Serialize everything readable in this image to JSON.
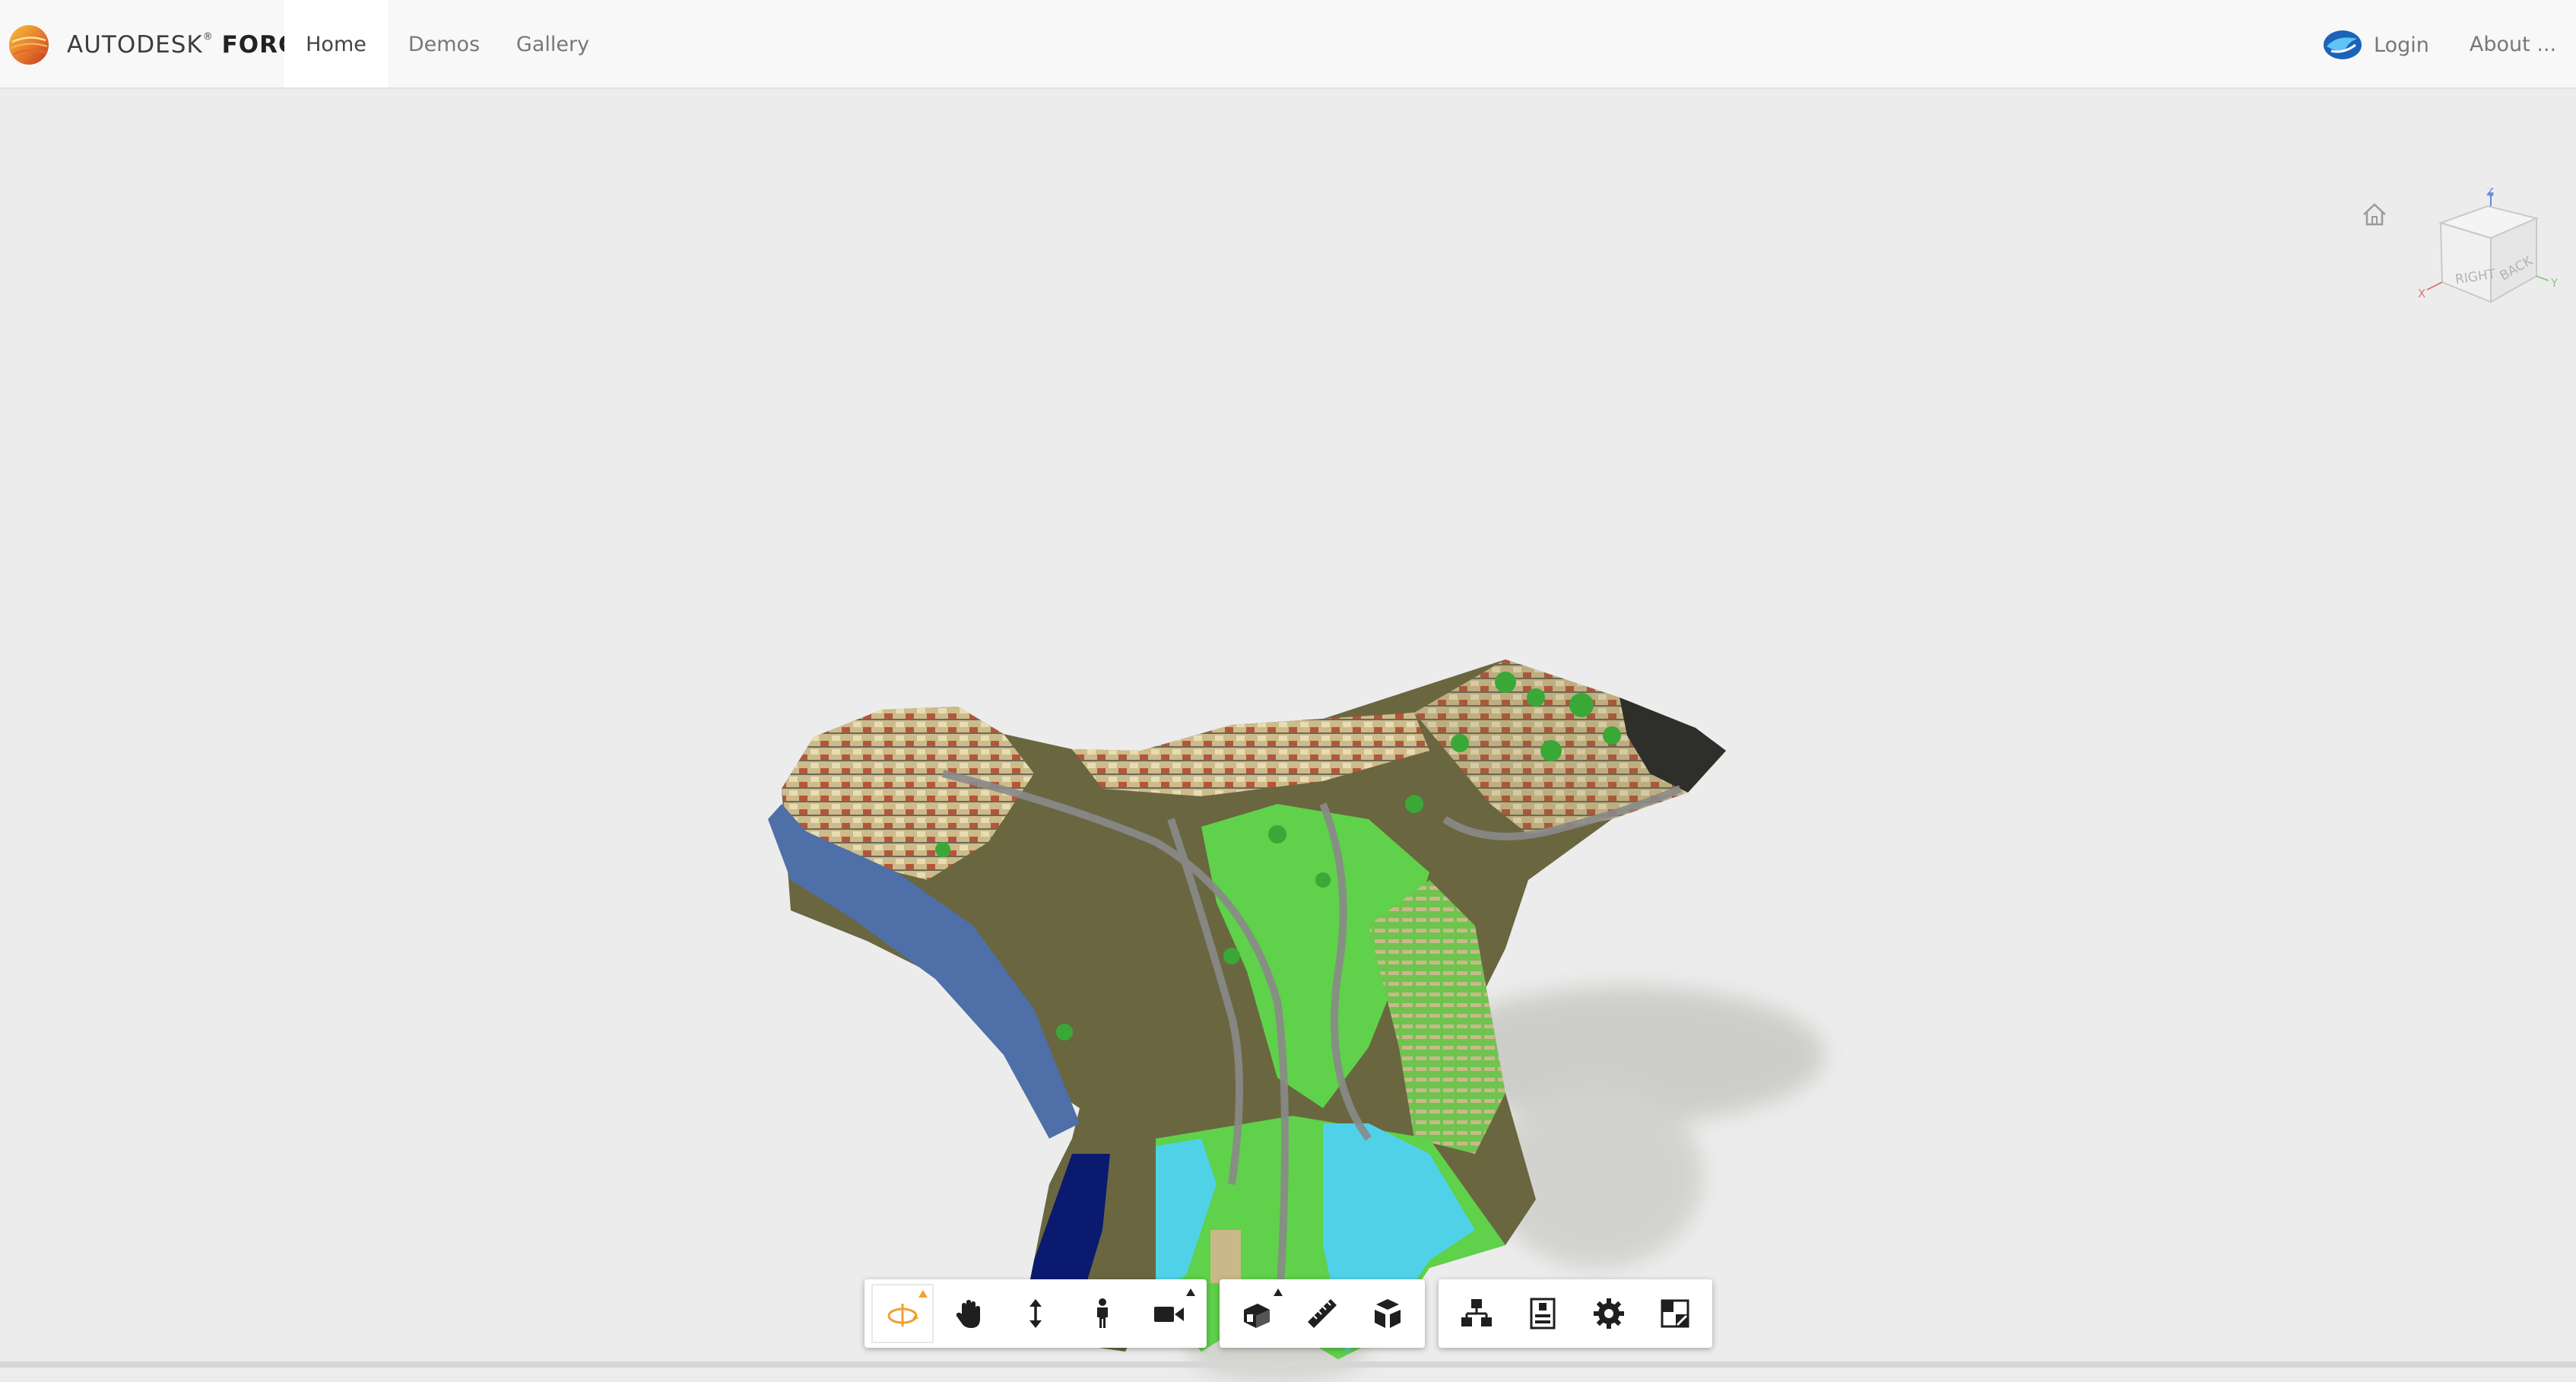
{
  "navbar": {
    "brand_prefix": "AUTODESK",
    "brand_mark": "®",
    "brand_suffix": "FORGE",
    "links": [
      {
        "label": "Home",
        "active": true
      },
      {
        "label": "Demos",
        "active": false
      },
      {
        "label": "Gallery",
        "active": false
      }
    ],
    "login_label": "Login",
    "about_label": "About ..."
  },
  "viewcube": {
    "faces": [
      "RIGHT",
      "BACK"
    ],
    "axes": {
      "x": "X",
      "y": "Y",
      "z": "Z"
    }
  },
  "toolbar": {
    "navigation": [
      {
        "icon": "orbit-icon",
        "active": true,
        "flyout": true
      },
      {
        "icon": "pan-icon",
        "active": false,
        "flyout": false
      },
      {
        "icon": "zoom-icon",
        "active": false,
        "flyout": false
      },
      {
        "icon": "first-person-icon",
        "active": false,
        "flyout": false
      },
      {
        "icon": "camera-icon",
        "active": false,
        "flyout": true
      }
    ],
    "model_tools": [
      {
        "icon": "section-icon",
        "flyout": true
      },
      {
        "icon": "measure-icon",
        "flyout": false
      },
      {
        "icon": "explode-icon",
        "flyout": false
      }
    ],
    "settings": [
      {
        "icon": "model-browser-icon"
      },
      {
        "icon": "properties-icon"
      },
      {
        "icon": "settings-gear-icon"
      },
      {
        "icon": "fullscreen-icon"
      }
    ]
  },
  "colors": {
    "accent": "#f0a030",
    "viewer_background": "#ececec",
    "terrain_green": "#5fd14a",
    "water_blue": "#4fd2e8",
    "deep_water": "#0a1a6e"
  }
}
